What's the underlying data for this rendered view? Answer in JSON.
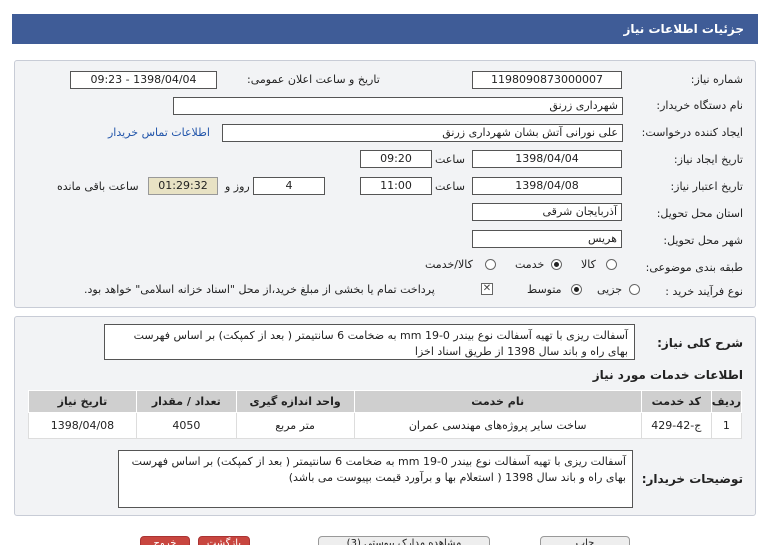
{
  "header": {
    "title": "جزئیات اطلاعات نیاز"
  },
  "form": {
    "need_number": {
      "label": "شماره نیاز:",
      "value": "1198090873000007"
    },
    "announce": {
      "label": "تاریخ و ساعت اعلان عمومی:",
      "value": "1398/04/04 - 09:23"
    },
    "buyer_org": {
      "label": "نام دستگاه خریدار:",
      "value": "شهرداری زرنق"
    },
    "requester": {
      "label": "ایجاد کننده درخواست:",
      "value": "علی نورانی آتش بشان  شهرداری زرنق",
      "contact_link": "اطلاعات تماس خریدار"
    },
    "created": {
      "label": "تاریخ ایجاد نیاز:",
      "date": "1398/04/04",
      "time_label": "ساعت",
      "time": "09:20"
    },
    "validity": {
      "label": "تاریخ اعتبار نیاز:",
      "date": "1398/04/08",
      "time_label": "ساعت",
      "time": "11:00",
      "days": "4",
      "days_label": "روز و",
      "remaining": "01:29:32",
      "remaining_label": "ساعت باقی مانده"
    },
    "province": {
      "label": "استان محل تحویل:",
      "value": "آذربایجان شرقی"
    },
    "city": {
      "label": "شهر محل تحویل:",
      "value": "هریس"
    },
    "category": {
      "label": "طبقه بندی موضوعی:",
      "options": [
        "کالا",
        "خدمت",
        "کالا/خدمت"
      ],
      "selected": "خدمت"
    },
    "process": {
      "label": "نوع فرآیند خرید :",
      "options": [
        "جزیی",
        "متوسط"
      ],
      "selected": "متوسط",
      "note": "پرداخت تمام یا بخشی از مبلغ خرید،از محل \"اسناد خزانه اسلامی\" خواهد بود."
    }
  },
  "description": {
    "label": "شرح کلی نیاز:",
    "text": "آسفالت ریزی با تهیه آسفالت نوع بیندر mm 19-0 به ضخامت 6 سانتیمتر ( بعد از کمپکت) بر اساس فهرست بهای راه و باند سال 1398 از طریق اسناد اخزا"
  },
  "services": {
    "title": "اطلاعات خدمات مورد نیاز",
    "columns": [
      "ردیف",
      "کد خدمت",
      "نام خدمت",
      "واحد اندازه گیری",
      "تعداد / مقدار",
      "تاریخ نیاز"
    ],
    "rows": [
      [
        "1",
        "ج-42-429",
        "ساخت سایر پروژه‌های مهندسی عمران",
        "متر مربع",
        "4050",
        "1398/04/08"
      ]
    ]
  },
  "buyer_notes": {
    "label": "توضیحات خریدار:",
    "text": "آسفالت ریزی با تهیه آسفالت نوع بیندر mm 19-0 به ضخامت 6 سانتیمتر ( بعد از کمپکت) بر اساس فهرست بهای راه و باند سال 1398 ( استعلام بها و برآورد قیمت بپیوست می باشد)"
  },
  "footer": {
    "buttons": [
      "چاپ",
      "مشاهده مدارک پیوستی (3)",
      "بازگشت",
      "خروج"
    ]
  },
  "colors": {
    "header_bg": "#3f5c97",
    "link": "#2255aa",
    "table_header": "#cfcfcf"
  }
}
